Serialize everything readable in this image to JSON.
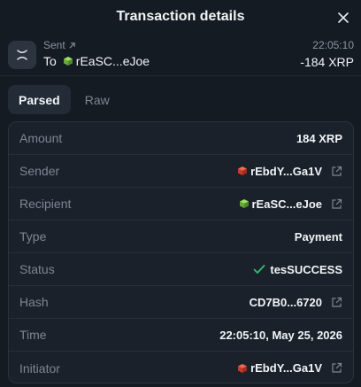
{
  "header": {
    "title": "Transaction details"
  },
  "summary": {
    "direction": "Sent",
    "to_prefix": "To",
    "recipient": "rEaSC...eJoe",
    "time": "22:05:10",
    "amount": "-184 XRP"
  },
  "tabs": [
    {
      "label": "Parsed",
      "active": true
    },
    {
      "label": "Raw",
      "active": false
    }
  ],
  "details": {
    "amount": {
      "label": "Amount",
      "value": "184 XRP"
    },
    "sender": {
      "label": "Sender",
      "value": "rEbdY...Ga1V"
    },
    "recipient": {
      "label": "Recipient",
      "value": "rEaSC...eJoe"
    },
    "type": {
      "label": "Type",
      "value": "Payment"
    },
    "status": {
      "label": "Status",
      "value": "tesSUCCESS"
    },
    "hash": {
      "label": "Hash",
      "value": "CD7B0...6720"
    },
    "time": {
      "label": "Time",
      "value": "22:05:10, May 25, 2026"
    },
    "initiator": {
      "label": "Initiator",
      "value": "rEbdY...Ga1V"
    }
  },
  "colors": {
    "background": "#151b23",
    "panel": "#1a212a",
    "success": "#2fbf71",
    "sender_cube": "#e0452f",
    "recipient_cube": "#7fc24a"
  },
  "icons": {
    "close": "close-icon",
    "tx": "tx-type-icon",
    "external": "external-link-icon",
    "check": "check-icon"
  }
}
